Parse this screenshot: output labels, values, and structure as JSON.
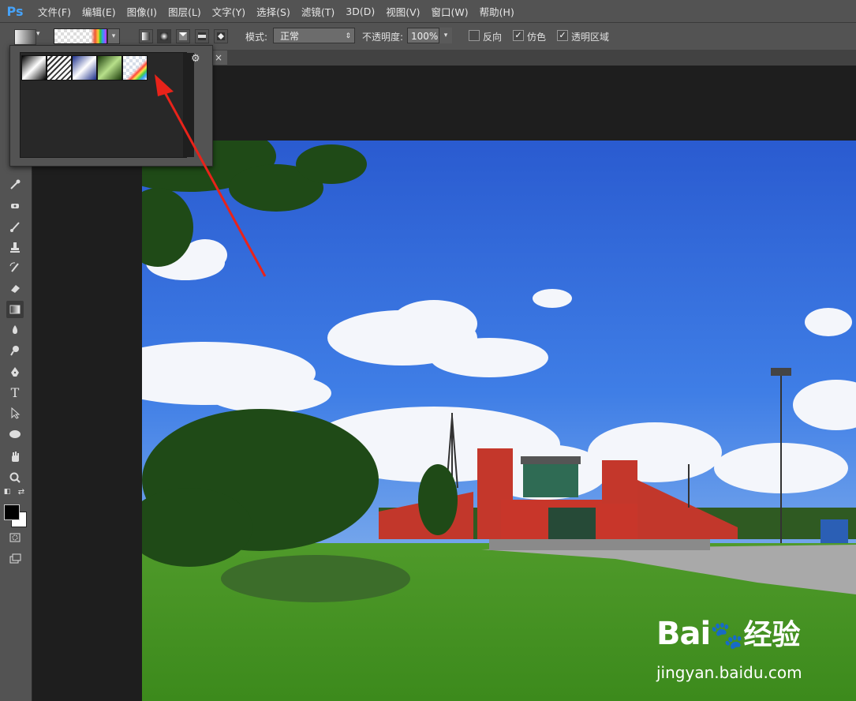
{
  "menubar": {
    "logo": "Ps",
    "items": [
      "文件(F)",
      "编辑(E)",
      "图像(I)",
      "图层(L)",
      "文字(Y)",
      "选择(S)",
      "滤镜(T)",
      "3D(D)",
      "视图(V)",
      "窗口(W)",
      "帮助(H)"
    ]
  },
  "options": {
    "mode_label": "模式:",
    "mode_value": "正常",
    "opacity_label": "不透明度:",
    "opacity_value": "100%",
    "reverse_label": "反向",
    "reverse_checked": false,
    "dither_label": "仿色",
    "dither_checked": true,
    "transparency_label": "透明区域",
    "transparency_checked": true
  },
  "tab": {
    "close": "×"
  },
  "tools": [
    "eyedropper-tool",
    "spot-healing-tool",
    "brush-tool",
    "clone-stamp-tool",
    "history-brush-tool",
    "eraser-tool",
    "gradient-tool",
    "blur-tool",
    "dodge-tool",
    "pen-tool",
    "type-tool",
    "path-selection-tool",
    "ellipse-tool",
    "hand-tool",
    "zoom-tool"
  ],
  "type_tool_glyph": "T",
  "gradient_presets": [
    "foreground-to-background",
    "transparent-stripes",
    "blue-yellow-blue",
    "green-gradient",
    "transparent-rainbow"
  ],
  "watermark": {
    "brand_left": "Bai",
    "brand_right": "经验",
    "url": "jingyan.baidu.com"
  }
}
